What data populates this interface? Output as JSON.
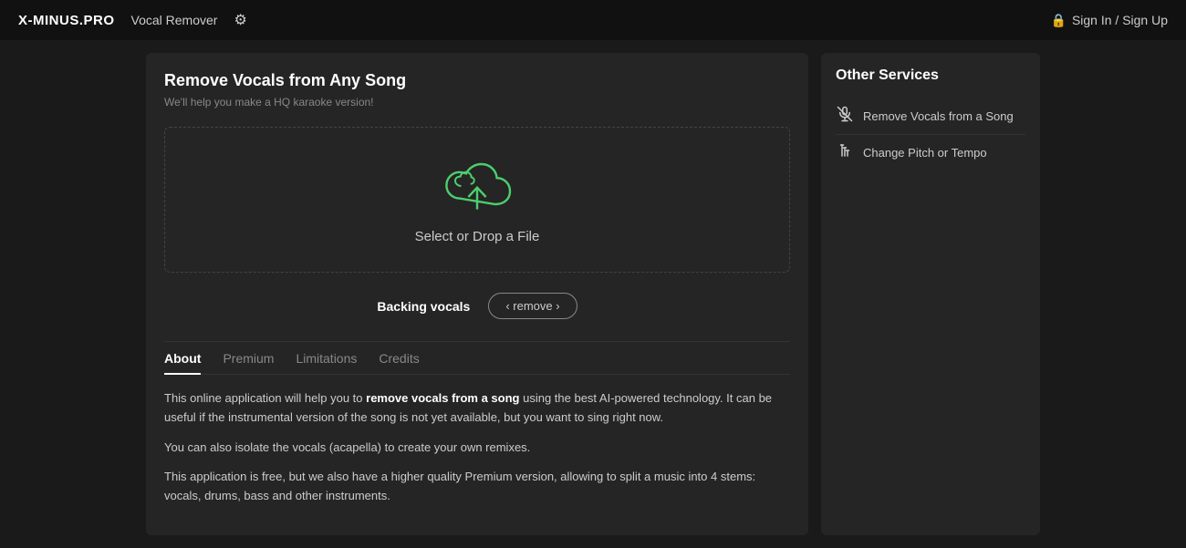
{
  "header": {
    "brand": "X-MINUS.PRO",
    "nav_vocal_remover": "Vocal Remover",
    "gear_symbol": "⚙",
    "sign_in_label": "Sign In / Sign Up",
    "lock_symbol": "🔒"
  },
  "left_panel": {
    "title": "Remove Vocals from Any Song",
    "subtitle": "We'll help you make a HQ karaoke version!",
    "upload_label": "Select or Drop a File",
    "backing_vocals_label": "Backing vocals",
    "remove_btn_label": "‹ remove ›"
  },
  "tabs": [
    {
      "id": "about",
      "label": "About",
      "active": true
    },
    {
      "id": "premium",
      "label": "Premium",
      "active": false
    },
    {
      "id": "limitations",
      "label": "Limitations",
      "active": false
    },
    {
      "id": "credits",
      "label": "Credits",
      "active": false
    }
  ],
  "about": {
    "paragraph1_prefix": "This online application will help you to ",
    "paragraph1_bold": "remove vocals from a song",
    "paragraph1_suffix": " using the best AI-powered technology. It can be useful if the instrumental version of the song is not yet available, but you want to sing right now.",
    "paragraph2": "You can also isolate the vocals (acapella) to create your own remixes.",
    "paragraph3": "This application is free, but we also have a higher quality Premium version, allowing to split a music into 4 stems: vocals, drums, bass and other instruments."
  },
  "right_panel": {
    "title": "Other Services",
    "services": [
      {
        "id": "remove-vocals",
        "icon": "🎤",
        "label": "Remove Vocals from a Song"
      },
      {
        "id": "change-pitch",
        "icon": "🎚",
        "label": "Change Pitch or Tempo"
      }
    ]
  }
}
